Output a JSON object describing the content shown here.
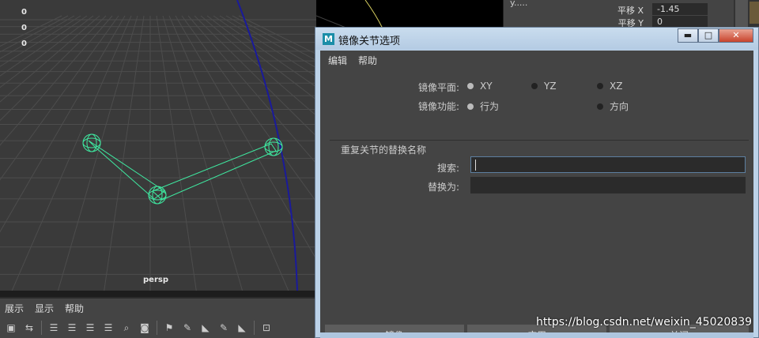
{
  "viewport": {
    "hud_values": [
      "0",
      "0",
      "0"
    ],
    "camera_label": "persp"
  },
  "panel_menu": [
    "展示",
    "显示",
    "帮助"
  ],
  "channel_box": {
    "title": "y.....",
    "rows": [
      {
        "label": "平移 X",
        "value": "-1.45"
      },
      {
        "label": "平移 Y",
        "value": "0"
      }
    ]
  },
  "dialog": {
    "title": "镜像关节选项",
    "app_icon": "M",
    "window_buttons": {
      "minimize": "▬",
      "maximize": "□",
      "close": "✕"
    },
    "menus": [
      "编辑",
      "帮助"
    ],
    "mirror_plane": {
      "label": "镜像平面:",
      "options": [
        {
          "label": "XY",
          "selected": true
        },
        {
          "label": "YZ",
          "selected": false
        },
        {
          "label": "XZ",
          "selected": false
        }
      ]
    },
    "mirror_function": {
      "label": "镜像功能:",
      "options": [
        {
          "label": "行为",
          "selected": true
        },
        {
          "label": "方向",
          "selected": false
        }
      ]
    },
    "replace_section_title": "重复关节的替换名称",
    "search": {
      "label": "搜索:",
      "value": ""
    },
    "replace": {
      "label": "替换为:",
      "value": ""
    },
    "buttons": {
      "mirror": "镜像",
      "apply": "应用",
      "close": "关闭"
    }
  },
  "watermark": "https://blog.csdn.net/weixin_45020839",
  "colors": {
    "viewport_bg": "#3a3a3a",
    "grid_line": "#4d4d4d",
    "joint_green": "#3fe8a0",
    "axis_blue": "#1a1a9a",
    "dialog_bg": "#444444"
  }
}
